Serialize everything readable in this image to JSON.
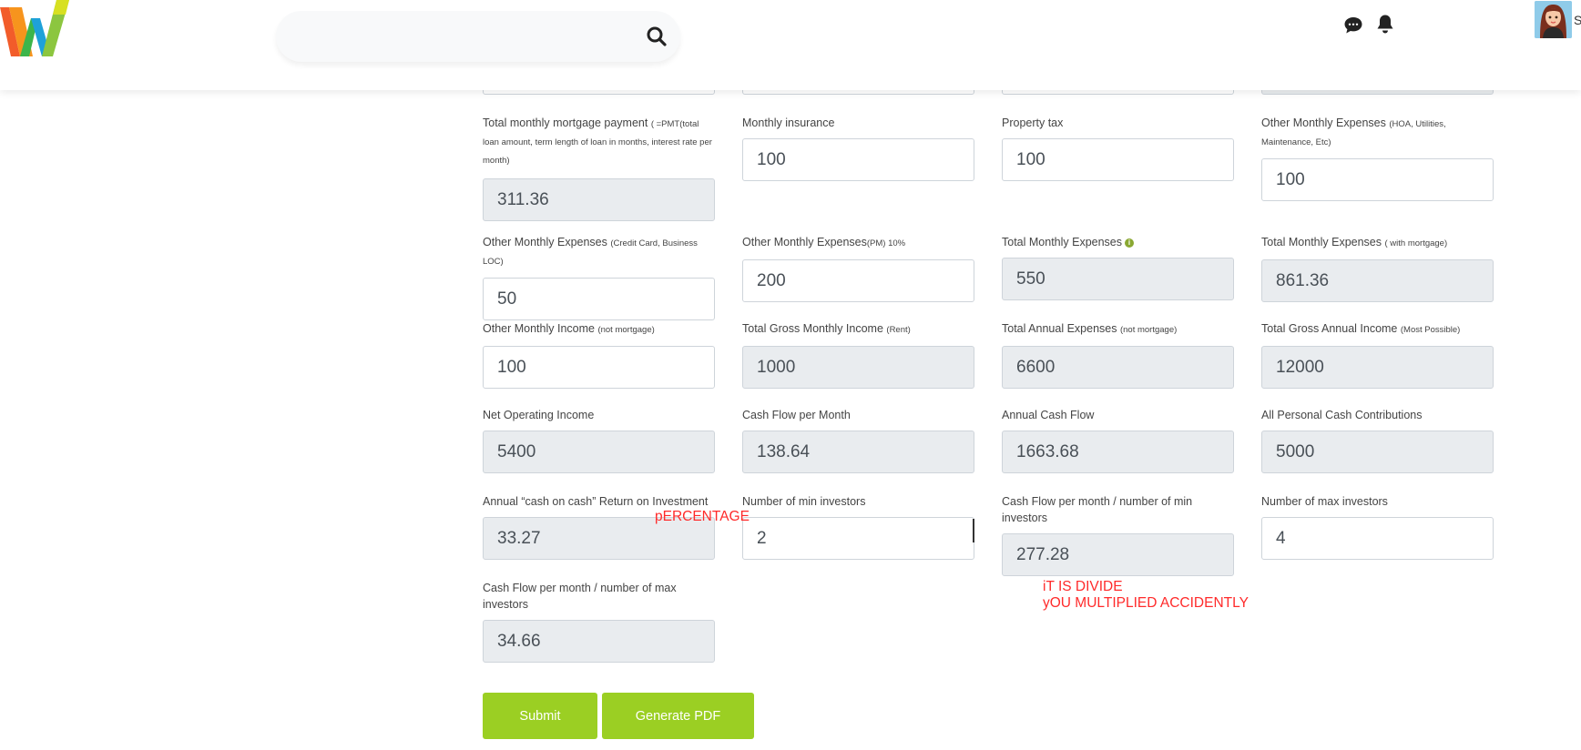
{
  "header": {
    "search": {
      "placeholder": ""
    },
    "icons": {
      "search": "search-icon",
      "chat": "chat-icon",
      "notifications": "bell-icon"
    },
    "user_initial": "S"
  },
  "colors": {
    "accent": "#9bcf23",
    "note": "#ff2a2a",
    "readonly_bg": "#e9ecef",
    "info_icon": "#8aa832"
  },
  "form": {
    "row1": {
      "mortgage": {
        "label": "Total monthly mortgage payment",
        "label_small": "( =PMT(total loan amount, term length of loan in months, interest rate per month)",
        "value": "311.36"
      },
      "insurance": {
        "label": "Monthly insurance",
        "value": "100"
      },
      "property_tax": {
        "label": "Property tax",
        "value": "100"
      },
      "other_hoa": {
        "label": "Other Monthly Expenses",
        "label_small": "(HOA, Utilities, Maintenance, Etc)",
        "value": "100"
      }
    },
    "row2": {
      "other_cc": {
        "label": "Other Monthly Expenses",
        "label_small": "(Credit Card, Business LOC)",
        "value": "50"
      },
      "other_pm": {
        "label": "Other Monthly Expenses",
        "label_small": "(PM) 10%",
        "value": "200"
      },
      "total_exp": {
        "label": "Total Monthly Expenses",
        "value": "550"
      },
      "total_exp_mort": {
        "label": "Total Monthly Expenses",
        "label_small": "( with mortgage)",
        "value": "861.36"
      }
    },
    "row3": {
      "other_income": {
        "label": "Other Monthly Income",
        "label_small": "(not mortgage)",
        "value": "100"
      },
      "gross_monthly": {
        "label": "Total Gross Monthly Income",
        "label_small": "(Rent)",
        "value": "1000"
      },
      "annual_exp": {
        "label": "Total Annual Expenses",
        "label_small": "(not mortgage)",
        "value": "6600"
      },
      "gross_annual": {
        "label": "Total Gross Annual Income",
        "label_small": "(Most Possible)",
        "value": "12000"
      }
    },
    "row4": {
      "noi": {
        "label": "Net Operating Income",
        "value": "5400"
      },
      "cash_flow_month": {
        "label": "Cash Flow per Month",
        "value": "138.64"
      },
      "annual_cash_flow": {
        "label": "Annual Cash Flow",
        "value": "1663.68"
      },
      "contributions": {
        "label": "All Personal Cash Contributions",
        "value": "5000"
      }
    },
    "row5": {
      "coc": {
        "label": "Annual “cash on cash” Return on Investment",
        "value": "33.27"
      },
      "min_inv": {
        "label": "Number of min investors",
        "value": "2"
      },
      "cf_min": {
        "label": "Cash Flow per month / number of min investors",
        "value": "277.28"
      },
      "max_inv": {
        "label": "Number of max investors",
        "value": "4"
      }
    },
    "row6": {
      "cf_max": {
        "label": "Cash Flow per month / number of max investors",
        "value": "34.66"
      }
    }
  },
  "notes": {
    "percentage": "pERCENTAGE",
    "divide_line1": "iT IS DIVIDE",
    "divide_line2": "yOU MULTIPLIED ACCIDENTLY"
  },
  "buttons": {
    "submit": "Submit",
    "pdf": "Generate PDF"
  }
}
